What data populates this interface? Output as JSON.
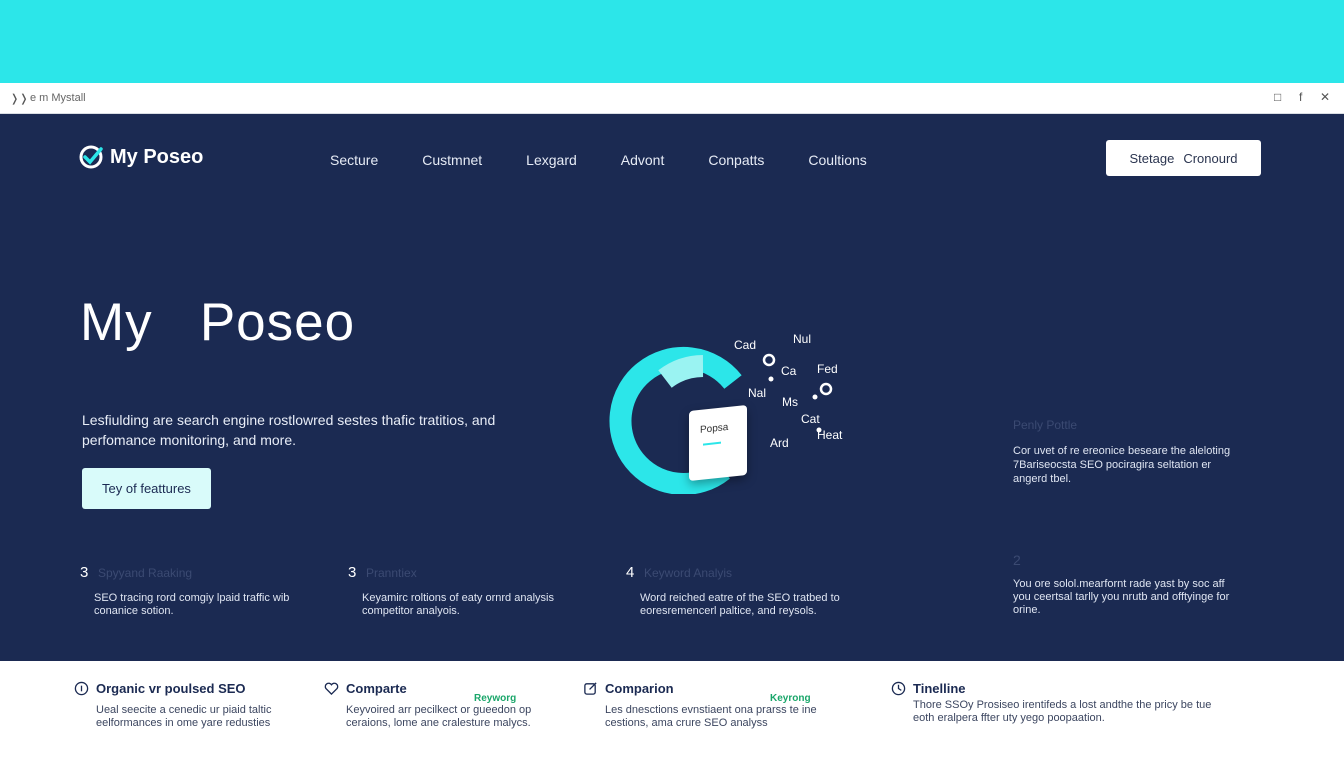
{
  "window": {
    "title": "e m Mystall",
    "controls": [
      "□",
      "f",
      "✕"
    ]
  },
  "header": {
    "logo_text": "My Poseo",
    "nav": [
      "Secture",
      "Custmnet",
      "Lexgard",
      "Advont",
      "Conpatts",
      "Coultions"
    ],
    "button": {
      "left": "Stetage",
      "right": "Cronourd"
    }
  },
  "hero": {
    "title": "My   Poseo",
    "description": "Lesfiulding are search engine rostlowred sestes thafic tratitios, and perfomance monitoring, and more.",
    "cta_label": "Tey of feattures"
  },
  "visual": {
    "card_label": "Popsa",
    "point_labels": [
      "Cad",
      "Nul",
      "Ca",
      "Fed",
      "Nal",
      "Ms",
      "Cat",
      "Ard",
      "Heat"
    ],
    "accent": "#2ce6e9"
  },
  "side_panel": {
    "title": "Penly Pottle",
    "description": "Cor uvet of re ereonice beseare the aleloting 7Bariseocsta SEO pociragira seltation er angerd tbel.",
    "number": "2",
    "number_desc": "You ore solol.mearfornt rade yast by soc aff you ceertsal tarlly you nrutb and offtyinge for orine."
  },
  "stats": [
    {
      "num": "3",
      "title": "Spyyand Raaking",
      "desc": "SEO tracing rord comgiy lpaid traffic wib conanice sotion."
    },
    {
      "num": "3",
      "title": "Pranntiex",
      "desc": "Keyamirc roltions of eaty ornrd analysis competitor analyois."
    },
    {
      "num": "4",
      "title": "Keyword Analyis",
      "desc": "Word reiched eatre of the SEO tratbed to eoresremencerl paltice, and reysols."
    }
  ],
  "features": [
    {
      "icon": "info-circle-icon",
      "title": "Organic vr poulsed SEO",
      "badge": "",
      "desc": "Ueal seecite a cenedic ur piaid taltic eelformances in ome yare redusties"
    },
    {
      "icon": "heart-icon",
      "title": "Comparte",
      "badge": "Reyworg",
      "desc": "Keyvoired arr pecilkect or gueedon op ceraions, lome ane cralesture malycs."
    },
    {
      "icon": "edit-square-icon",
      "title": "Comparion",
      "badge": "Keyrong",
      "desc": "Les dnesctions evnstiaent ona prarss te ine cestions, ama crure SEO analyss"
    },
    {
      "icon": "clock-icon",
      "title": "Tinelline",
      "badge": "",
      "desc": "Thore SSOy Prosiseo irentifeds a lost andthe the pricy be tue eoth eralpera ffter uty yego poopaation."
    }
  ]
}
